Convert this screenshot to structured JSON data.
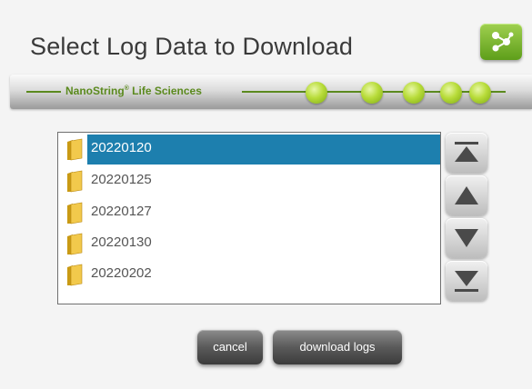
{
  "header": {
    "title": "Select Log Data to Download"
  },
  "banner": {
    "brand": "NanoString",
    "brand_mark": "®",
    "brand_suffix": " Life Sciences"
  },
  "list": {
    "items": [
      {
        "label": "20220120",
        "selected": true
      },
      {
        "label": "20220125",
        "selected": false
      },
      {
        "label": "20220127",
        "selected": false
      },
      {
        "label": "20220130",
        "selected": false
      },
      {
        "label": "20220202",
        "selected": false
      }
    ]
  },
  "scroll": {
    "icons": [
      "scroll-to-top-icon",
      "scroll-up-icon",
      "scroll-down-icon",
      "scroll-to-bottom-icon"
    ]
  },
  "actions": {
    "cancel_label": "cancel",
    "download_label": "download logs"
  },
  "colors": {
    "selection": "#1d7fae",
    "accent_green": "#7eaa14",
    "brand_text": "#5b8a1e"
  }
}
